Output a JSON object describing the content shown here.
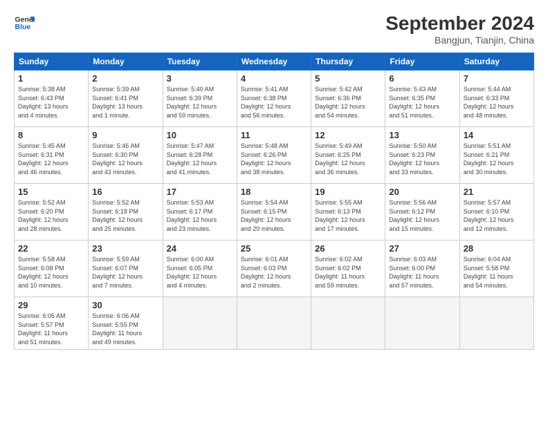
{
  "header": {
    "logo_line1": "General",
    "logo_line2": "Blue",
    "month": "September 2024",
    "location": "Bangjun, Tianjin, China"
  },
  "weekdays": [
    "Sunday",
    "Monday",
    "Tuesday",
    "Wednesday",
    "Thursday",
    "Friday",
    "Saturday"
  ],
  "weeks": [
    [
      {
        "day": "1",
        "lines": [
          "Sunrise: 5:38 AM",
          "Sunset: 6:43 PM",
          "Daylight: 13 hours",
          "and 4 minutes."
        ]
      },
      {
        "day": "2",
        "lines": [
          "Sunrise: 5:39 AM",
          "Sunset: 6:41 PM",
          "Daylight: 13 hours",
          "and 1 minute."
        ]
      },
      {
        "day": "3",
        "lines": [
          "Sunrise: 5:40 AM",
          "Sunset: 6:39 PM",
          "Daylight: 12 hours",
          "and 59 minutes."
        ]
      },
      {
        "day": "4",
        "lines": [
          "Sunrise: 5:41 AM",
          "Sunset: 6:38 PM",
          "Daylight: 12 hours",
          "and 56 minutes."
        ]
      },
      {
        "day": "5",
        "lines": [
          "Sunrise: 5:42 AM",
          "Sunset: 6:36 PM",
          "Daylight: 12 hours",
          "and 54 minutes."
        ]
      },
      {
        "day": "6",
        "lines": [
          "Sunrise: 5:43 AM",
          "Sunset: 6:35 PM",
          "Daylight: 12 hours",
          "and 51 minutes."
        ]
      },
      {
        "day": "7",
        "lines": [
          "Sunrise: 5:44 AM",
          "Sunset: 6:33 PM",
          "Daylight: 12 hours",
          "and 48 minutes."
        ]
      }
    ],
    [
      {
        "day": "8",
        "lines": [
          "Sunrise: 5:45 AM",
          "Sunset: 6:31 PM",
          "Daylight: 12 hours",
          "and 46 minutes."
        ]
      },
      {
        "day": "9",
        "lines": [
          "Sunrise: 5:46 AM",
          "Sunset: 6:30 PM",
          "Daylight: 12 hours",
          "and 43 minutes."
        ]
      },
      {
        "day": "10",
        "lines": [
          "Sunrise: 5:47 AM",
          "Sunset: 6:28 PM",
          "Daylight: 12 hours",
          "and 41 minutes."
        ]
      },
      {
        "day": "11",
        "lines": [
          "Sunrise: 5:48 AM",
          "Sunset: 6:26 PM",
          "Daylight: 12 hours",
          "and 38 minutes."
        ]
      },
      {
        "day": "12",
        "lines": [
          "Sunrise: 5:49 AM",
          "Sunset: 6:25 PM",
          "Daylight: 12 hours",
          "and 36 minutes."
        ]
      },
      {
        "day": "13",
        "lines": [
          "Sunrise: 5:50 AM",
          "Sunset: 6:23 PM",
          "Daylight: 12 hours",
          "and 33 minutes."
        ]
      },
      {
        "day": "14",
        "lines": [
          "Sunrise: 5:51 AM",
          "Sunset: 6:21 PM",
          "Daylight: 12 hours",
          "and 30 minutes."
        ]
      }
    ],
    [
      {
        "day": "15",
        "lines": [
          "Sunrise: 5:52 AM",
          "Sunset: 6:20 PM",
          "Daylight: 12 hours",
          "and 28 minutes."
        ]
      },
      {
        "day": "16",
        "lines": [
          "Sunrise: 5:52 AM",
          "Sunset: 6:18 PM",
          "Daylight: 12 hours",
          "and 25 minutes."
        ]
      },
      {
        "day": "17",
        "lines": [
          "Sunrise: 5:53 AM",
          "Sunset: 6:17 PM",
          "Daylight: 12 hours",
          "and 23 minutes."
        ]
      },
      {
        "day": "18",
        "lines": [
          "Sunrise: 5:54 AM",
          "Sunset: 6:15 PM",
          "Daylight: 12 hours",
          "and 20 minutes."
        ]
      },
      {
        "day": "19",
        "lines": [
          "Sunrise: 5:55 AM",
          "Sunset: 6:13 PM",
          "Daylight: 12 hours",
          "and 17 minutes."
        ]
      },
      {
        "day": "20",
        "lines": [
          "Sunrise: 5:56 AM",
          "Sunset: 6:12 PM",
          "Daylight: 12 hours",
          "and 15 minutes."
        ]
      },
      {
        "day": "21",
        "lines": [
          "Sunrise: 5:57 AM",
          "Sunset: 6:10 PM",
          "Daylight: 12 hours",
          "and 12 minutes."
        ]
      }
    ],
    [
      {
        "day": "22",
        "lines": [
          "Sunrise: 5:58 AM",
          "Sunset: 6:08 PM",
          "Daylight: 12 hours",
          "and 10 minutes."
        ]
      },
      {
        "day": "23",
        "lines": [
          "Sunrise: 5:59 AM",
          "Sunset: 6:07 PM",
          "Daylight: 12 hours",
          "and 7 minutes."
        ]
      },
      {
        "day": "24",
        "lines": [
          "Sunrise: 6:00 AM",
          "Sunset: 6:05 PM",
          "Daylight: 12 hours",
          "and 4 minutes."
        ]
      },
      {
        "day": "25",
        "lines": [
          "Sunrise: 6:01 AM",
          "Sunset: 6:03 PM",
          "Daylight: 12 hours",
          "and 2 minutes."
        ]
      },
      {
        "day": "26",
        "lines": [
          "Sunrise: 6:02 AM",
          "Sunset: 6:02 PM",
          "Daylight: 11 hours",
          "and 59 minutes."
        ]
      },
      {
        "day": "27",
        "lines": [
          "Sunrise: 6:03 AM",
          "Sunset: 6:00 PM",
          "Daylight: 11 hours",
          "and 57 minutes."
        ]
      },
      {
        "day": "28",
        "lines": [
          "Sunrise: 6:04 AM",
          "Sunset: 5:58 PM",
          "Daylight: 11 hours",
          "and 54 minutes."
        ]
      }
    ],
    [
      {
        "day": "29",
        "lines": [
          "Sunrise: 6:05 AM",
          "Sunset: 5:57 PM",
          "Daylight: 11 hours",
          "and 51 minutes."
        ]
      },
      {
        "day": "30",
        "lines": [
          "Sunrise: 6:06 AM",
          "Sunset: 5:55 PM",
          "Daylight: 11 hours",
          "and 49 minutes."
        ]
      },
      {
        "day": "",
        "lines": []
      },
      {
        "day": "",
        "lines": []
      },
      {
        "day": "",
        "lines": []
      },
      {
        "day": "",
        "lines": []
      },
      {
        "day": "",
        "lines": []
      }
    ]
  ]
}
